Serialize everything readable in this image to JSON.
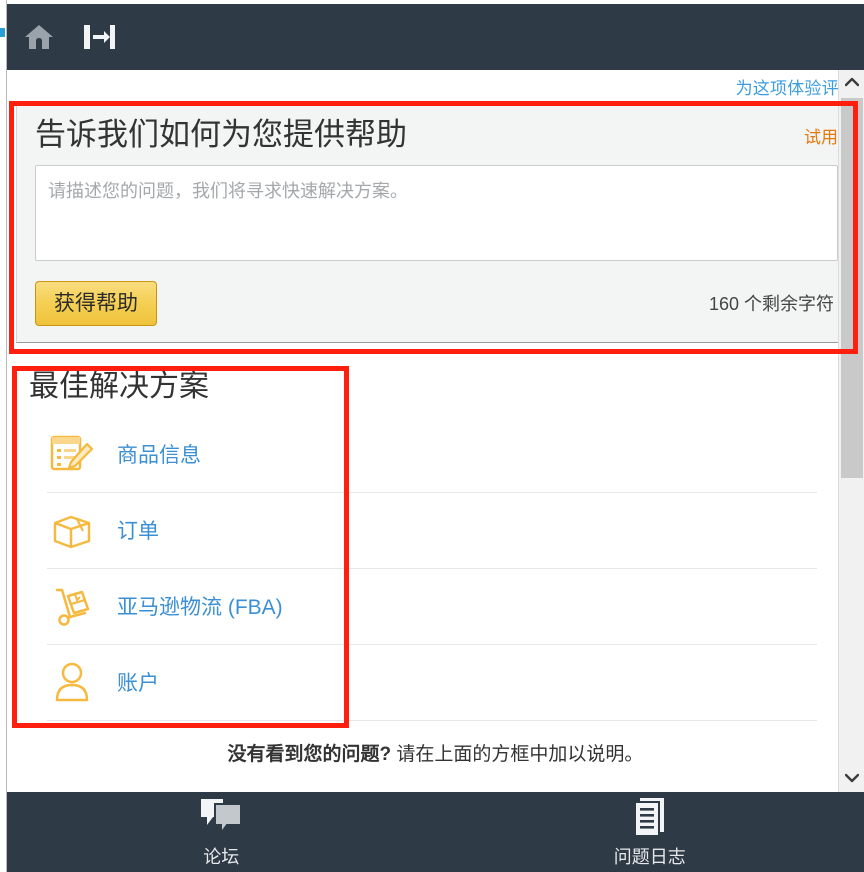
{
  "topbar": {
    "home_icon": "home-icon",
    "exit_icon": "sign-out-icon"
  },
  "rate": {
    "link_label": "为这项体验评分"
  },
  "help_card": {
    "title": "告诉我们如何为您提供帮助",
    "trial_badge": "试用",
    "textarea_placeholder": "请描述您的问题，我们将寻求快速解决方案。",
    "textarea_value": "",
    "submit_label": "获得帮助",
    "char_count": "160 个剩余字符"
  },
  "solutions": {
    "title": "最佳解决方案",
    "items": [
      {
        "label": "商品信息",
        "icon": "listing-edit-icon"
      },
      {
        "label": "订单",
        "icon": "box-icon"
      },
      {
        "label": "亚马逊物流 (FBA)",
        "icon": "hand-truck-icon"
      },
      {
        "label": "账户",
        "icon": "person-icon"
      }
    ]
  },
  "no_issue": {
    "bold": "没有看到您的问题?",
    "rest": " 请在上面的方框中加以说明。"
  },
  "scrollbar": {
    "up_icon": "chevron-up-icon",
    "down_icon": "chevron-down-icon"
  },
  "bottom_nav": [
    {
      "label": "论坛",
      "icon": "forums-icon"
    },
    {
      "label": "问题日志",
      "icon": "case-log-icon"
    }
  ],
  "colors": {
    "chrome_dark": "#2f3a47",
    "link_blue": "#3b8fd4",
    "rate_blue": "#3b9ddd",
    "accent_orange": "#e47911",
    "button_gold": "#f5cf52",
    "icon_orange": "#f6b93f",
    "annotation_red": "#ff1f0f",
    "card_grey": "#f3f4f4"
  }
}
